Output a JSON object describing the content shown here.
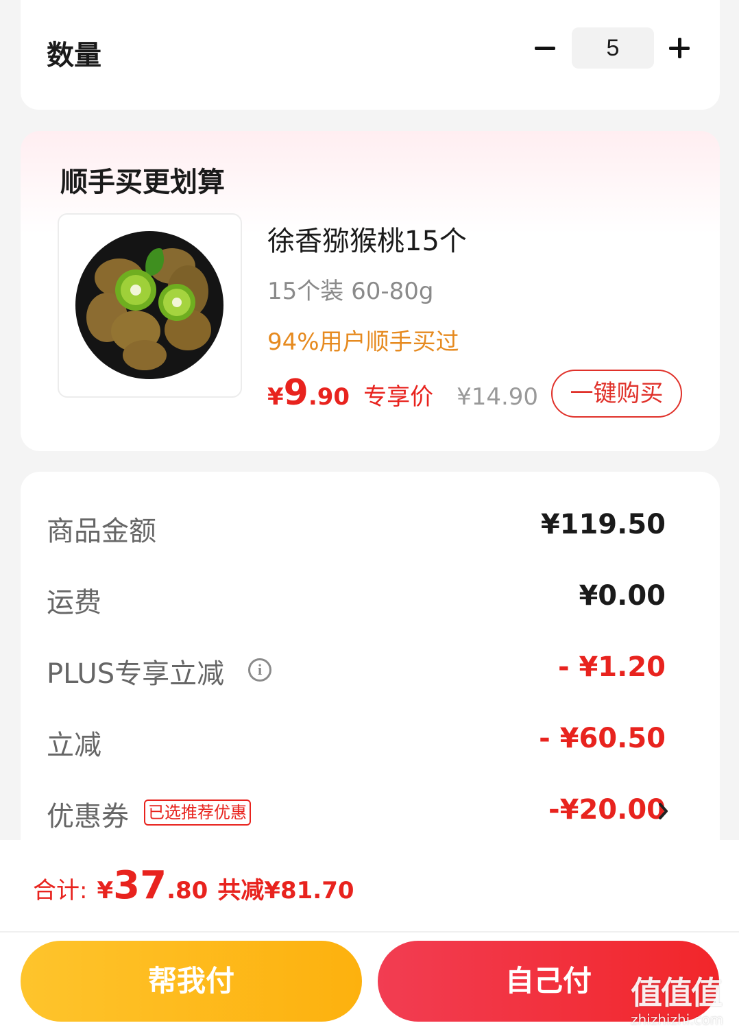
{
  "quantity": {
    "label": "数量",
    "value": "5"
  },
  "upsell": {
    "title": "顺手买更划算",
    "product": {
      "name": "徐香猕猴桃15个",
      "spec": "15个装  60-80g",
      "social_proof": "94%用户顺手买过",
      "price_yen": "¥",
      "price_int": "9",
      "price_dec": ".90",
      "price_tag": "专享价",
      "original_price": "¥14.90",
      "buy_button": "一键购买",
      "image_icon": "kiwi-fruit-plate"
    }
  },
  "summary": {
    "rows": [
      {
        "label": "商品金额",
        "value": "¥119.50"
      },
      {
        "label": "运费",
        "value": "¥0.00"
      },
      {
        "label": "PLUS专享立减",
        "value": "- ¥1.20",
        "info_icon": "i"
      },
      {
        "label": "立减",
        "value": "- ¥60.50"
      },
      {
        "label": "优惠券",
        "badge": "已选推荐优惠",
        "value": "-¥20.00"
      }
    ]
  },
  "total": {
    "label": "合计:",
    "yen": "¥",
    "int": "37",
    "dec": ".80",
    "saved": "共减¥81.70"
  },
  "actions": {
    "help_pay": "帮我付",
    "self_pay": "自己付"
  },
  "watermark": {
    "main": "值值值",
    "sub": "zhizhizhi.com"
  },
  "colors": {
    "accent_red": "#e8231e",
    "orange": "#e68a1f",
    "help_btn": "#fdb10e",
    "self_btn": "#f2262a"
  }
}
